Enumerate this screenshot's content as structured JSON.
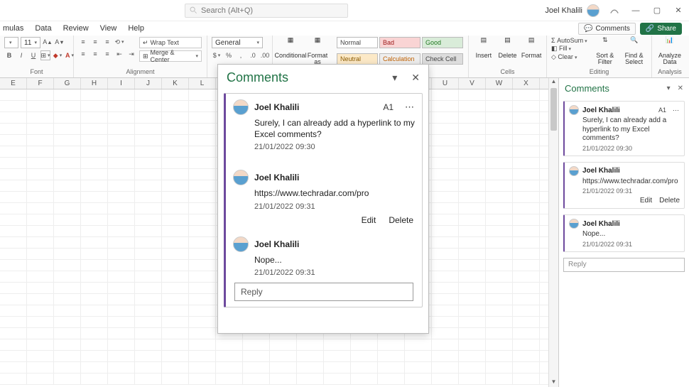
{
  "titlebar": {
    "search_placeholder": "Search (Alt+Q)",
    "user_name": "Joel Khalili"
  },
  "menutabs": {
    "items": [
      "mulas",
      "Data",
      "Review",
      "View",
      "Help"
    ],
    "comments_btn": "Comments",
    "share_btn": "Share"
  },
  "ribbon": {
    "font": {
      "size": "11",
      "title": "Font"
    },
    "alignment": {
      "wrap": "Wrap Text",
      "merge": "Merge & Center",
      "title": "Alignment"
    },
    "number": {
      "format": "General",
      "title": ""
    },
    "cond": {
      "btn1": "Conditional",
      "btn2": "Format as"
    },
    "styles": {
      "normal": "Normal",
      "bad": "Bad",
      "good": "Good",
      "neutral": "Neutral",
      "calc": "Calculation",
      "check": "Check Cell"
    },
    "cells": {
      "insert": "Insert",
      "delete": "Delete",
      "format": "Format",
      "title": "Cells"
    },
    "editing": {
      "autosum": "AutoSum",
      "fill": "Fill",
      "clear": "Clear",
      "sort": "Sort & Filter",
      "find": "Find & Select",
      "title": "Editing"
    },
    "analysis": {
      "analyze": "Analyze Data",
      "title": "Analysis"
    }
  },
  "sheet": {
    "cols": [
      "E",
      "F",
      "G",
      "H",
      "I",
      "J",
      "K",
      "L",
      "",
      "",
      "",
      "",
      "",
      "",
      "",
      "",
      "U",
      "V",
      "W",
      "X"
    ]
  },
  "float_panel": {
    "title": "Comments",
    "thread": {
      "cell": "A1",
      "comments": [
        {
          "author": "Joel Khalili",
          "body": "Surely, I can already add a hyperlink to my Excel comments?",
          "ts": "21/01/2022 09:30"
        },
        {
          "author": "Joel Khalili",
          "body": "https://www.techradar.com/pro",
          "ts": "21/01/2022 09:31",
          "edit": "Edit",
          "delete": "Delete"
        },
        {
          "author": "Joel Khalili",
          "body": "Nope...",
          "ts": "21/01/2022 09:31"
        }
      ],
      "reply_placeholder": "Reply"
    }
  },
  "right_pane": {
    "title": "Comments",
    "thread": {
      "cell": "A1",
      "comments": [
        {
          "author": "Joel Khalili",
          "body": "Surely, I can already add a hyperlink to my Excel comments?",
          "ts": "21/01/2022 09:30"
        },
        {
          "author": "Joel Khalili",
          "body": "https://www.techradar.com/pro",
          "ts": "21/01/2022 09:31",
          "edit": "Edit",
          "delete": "Delete"
        },
        {
          "author": "Joel Khalili",
          "body": "Nope...",
          "ts": "21/01/2022 09:31"
        }
      ],
      "reply_placeholder": "Reply"
    }
  }
}
